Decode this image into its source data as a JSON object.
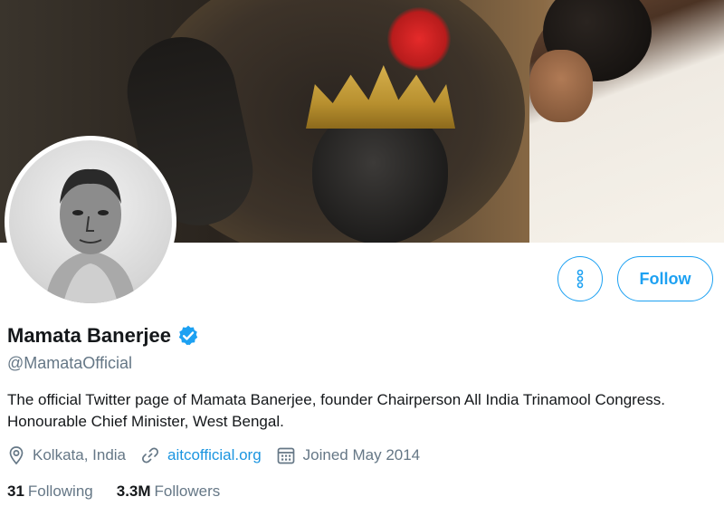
{
  "profile": {
    "name": "Mamata Banerjee",
    "handle": "@MamataOfficial",
    "bio": "The official Twitter page of Mamata Banerjee, founder Chairperson All India Trinamool Congress. Honourable Chief Minister, West Bengal.",
    "location": "Kolkata, India",
    "website": "aitcofficial.org",
    "joined": "Joined May 2014",
    "following_count": "31",
    "following_label": "Following",
    "followers_count": "3.3M",
    "followers_label": "Followers",
    "verified": true
  },
  "actions": {
    "follow_label": "Follow",
    "more_icon": "more-vertical-icon"
  },
  "icons": {
    "location": "location-pin-icon",
    "link": "link-icon",
    "calendar": "calendar-icon",
    "verified": "verified-badge-icon"
  },
  "colors": {
    "accent": "#1da1f2",
    "link": "#1b95e0",
    "muted": "#657786",
    "text": "#14171a"
  }
}
